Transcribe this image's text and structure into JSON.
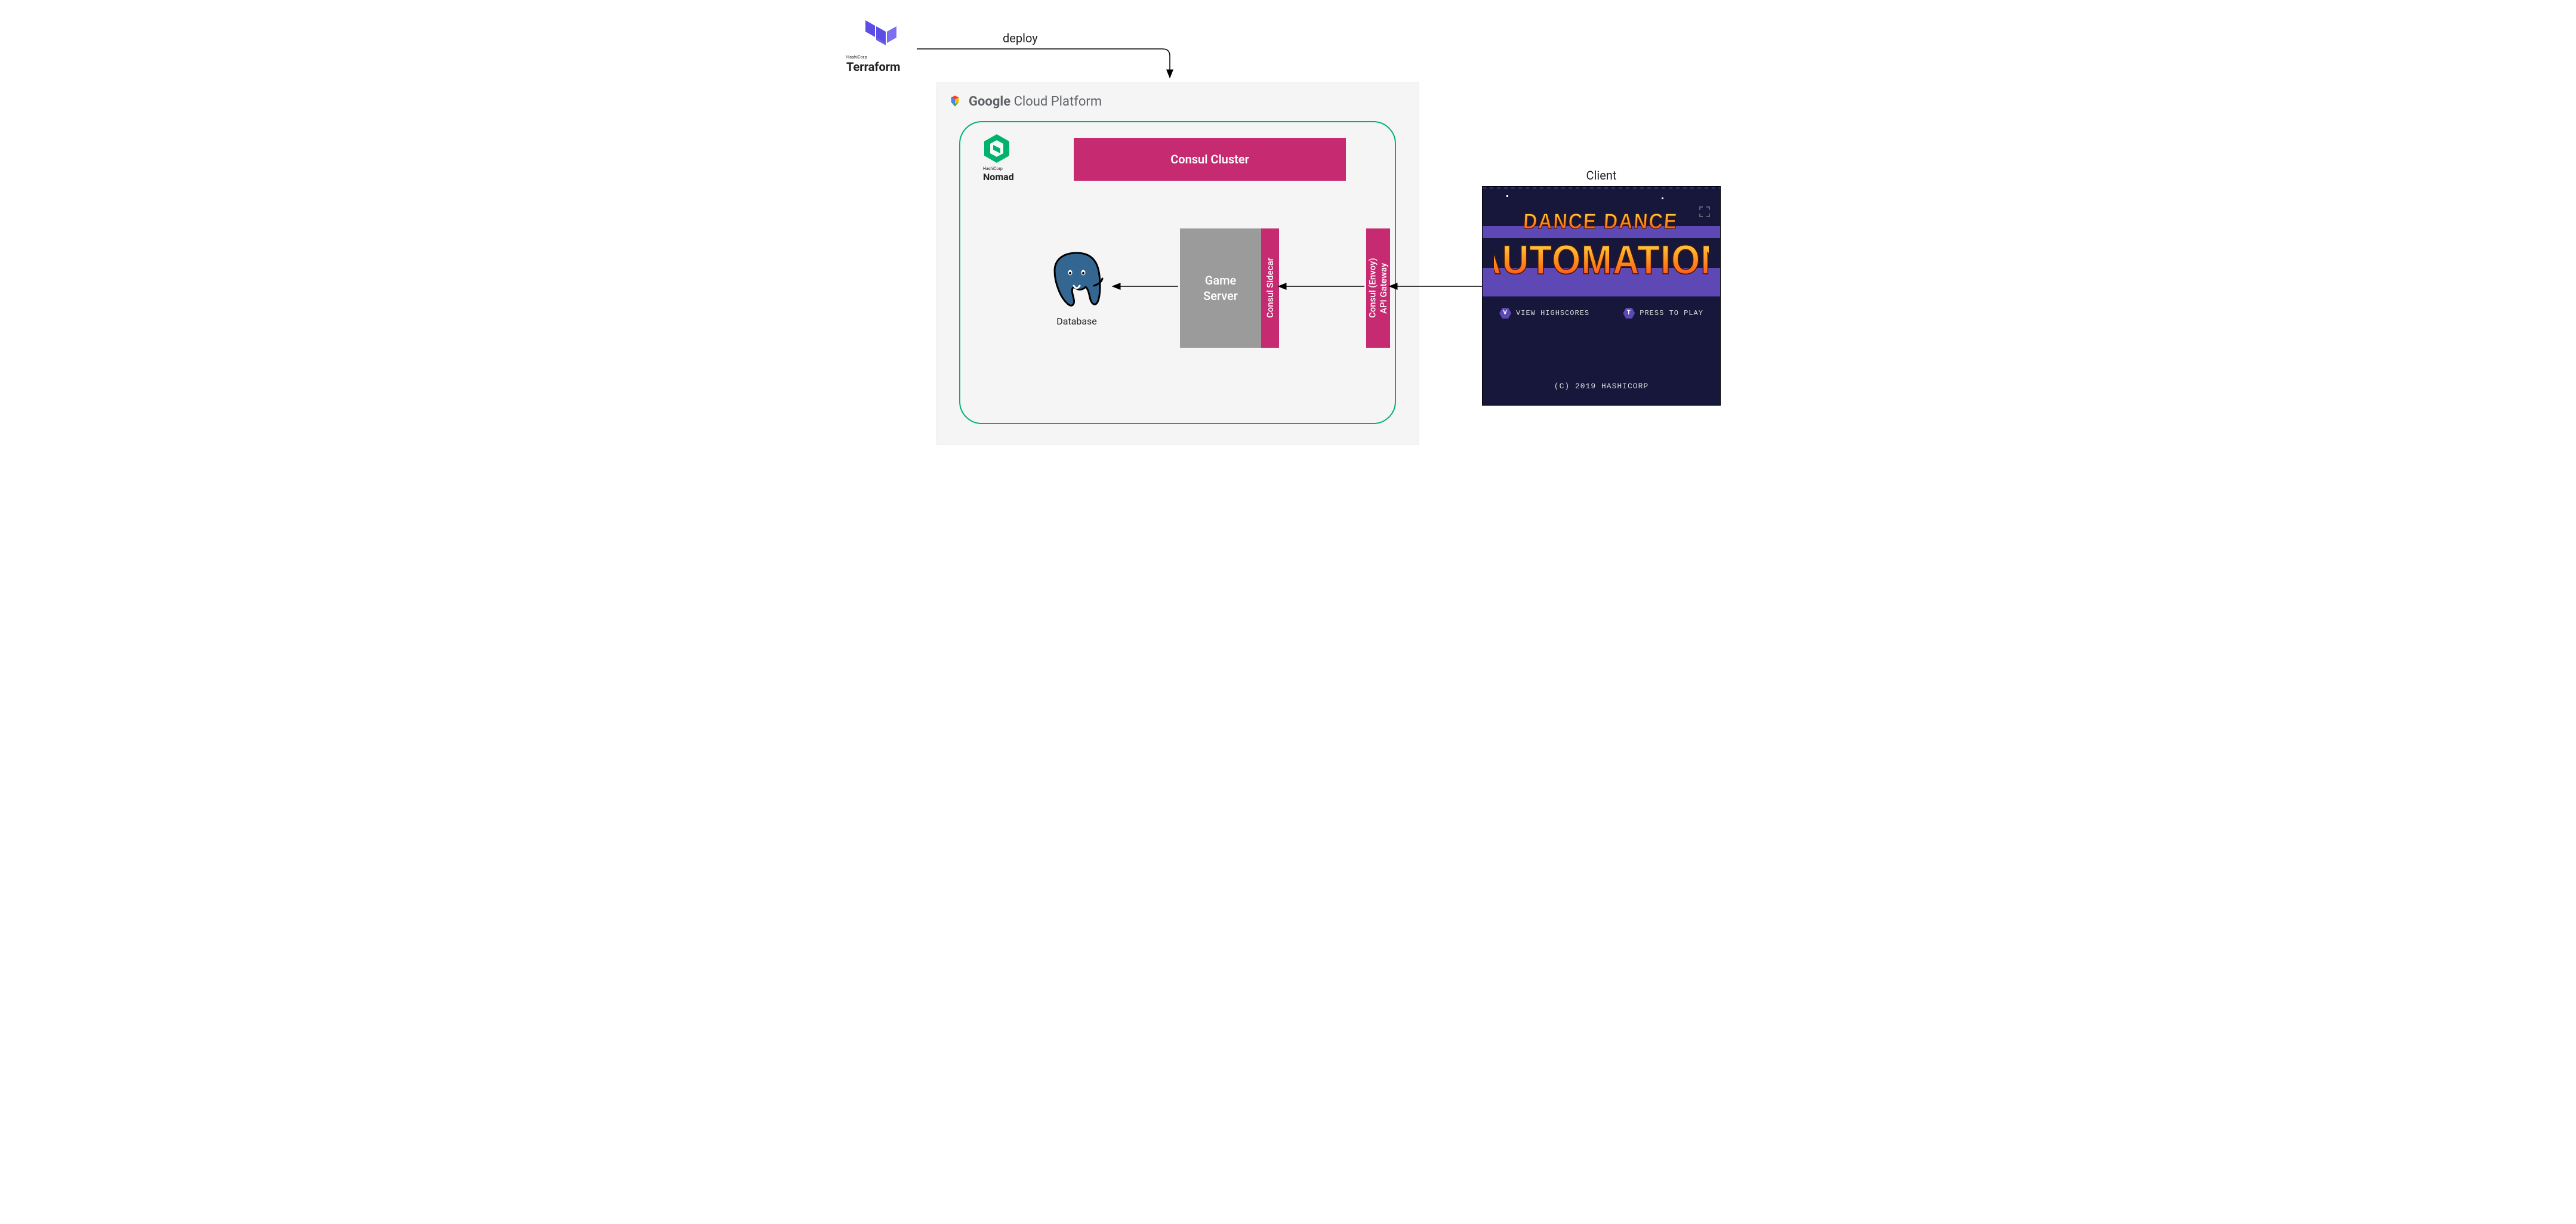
{
  "terraform": {
    "vendor": "HashiCorp",
    "name": "Terraform"
  },
  "arrows": {
    "deploy_label": "deploy"
  },
  "gcp": {
    "label_bold": "Google",
    "label_rest": "Cloud Platform"
  },
  "nomad": {
    "vendor": "HashiCorp",
    "name": "Nomad",
    "consul_cluster_label": "Consul Cluster",
    "database_label": "Database",
    "game_server_label": "Game\nServer",
    "consul_sidecar_label": "Consul Sidecar",
    "api_gateway_label": "Consul (Envoy)\nAPI Gateway"
  },
  "client": {
    "heading": "Client",
    "game_title_line1": "DANCE DANCE",
    "game_title_line2": "AUTOMATION",
    "controls": {
      "view_key": "V",
      "view_label": "VIEW HIGHSCORES",
      "play_key": "T",
      "play_label": "PRESS TO PLAY"
    },
    "copyright": "(C) 2019 HASHICORP"
  }
}
